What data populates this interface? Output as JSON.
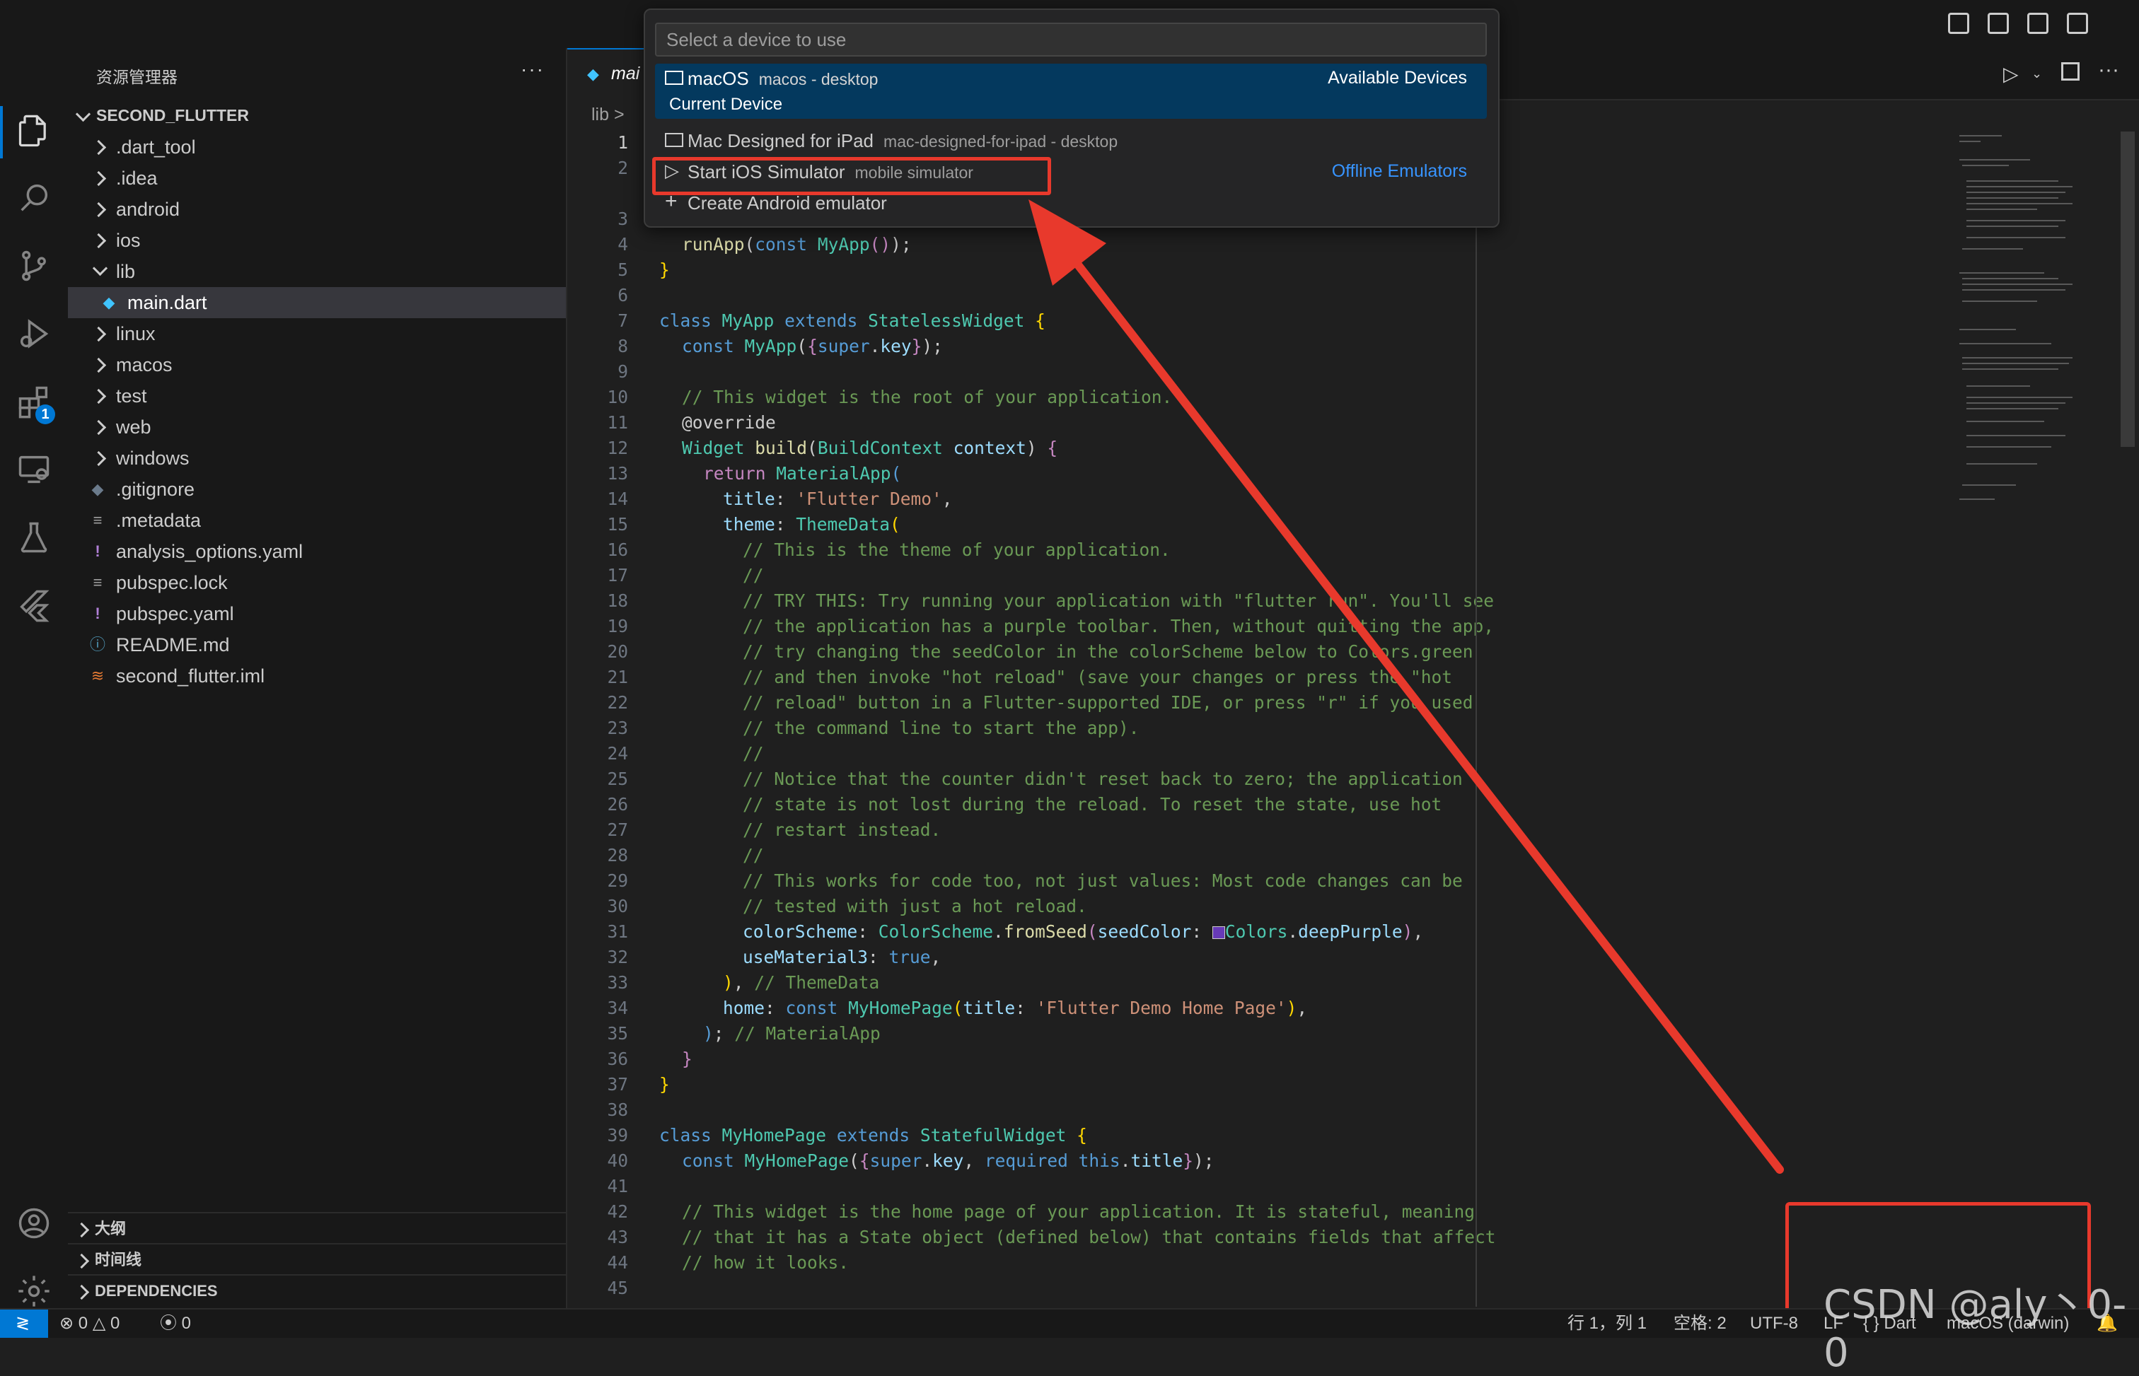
{
  "explorer": {
    "title": "资源管理器",
    "more": "···",
    "project": "SECOND_FLUTTER",
    "items": [
      {
        "label": ".dart_tool"
      },
      {
        "label": ".idea"
      },
      {
        "label": "android"
      },
      {
        "label": "ios"
      },
      {
        "label": "lib"
      },
      {
        "label": "main.dart"
      },
      {
        "label": "linux"
      },
      {
        "label": "macos"
      },
      {
        "label": "test"
      },
      {
        "label": "web"
      },
      {
        "label": "windows"
      },
      {
        "label": ".gitignore"
      },
      {
        "label": ".metadata"
      },
      {
        "label": "analysis_options.yaml"
      },
      {
        "label": "pubspec.lock"
      },
      {
        "label": "pubspec.yaml"
      },
      {
        "label": "README.md"
      },
      {
        "label": "second_flutter.iml"
      }
    ],
    "sections": {
      "outline": "大纲",
      "timeline": "时间线",
      "dependencies": "DEPENDENCIES"
    }
  },
  "activity": {
    "extensions_badge": "1"
  },
  "editor": {
    "tab": "mai",
    "breadcrumb": "lib >",
    "line_numbers": [
      "1",
      "2",
      "3",
      "4",
      "5",
      "6",
      "7",
      "8",
      "9",
      "10",
      "11",
      "12",
      "13",
      "14",
      "15",
      "16",
      "17",
      "18",
      "19",
      "20",
      "21",
      "22",
      "23",
      "24",
      "25",
      "26",
      "27",
      "28",
      "29",
      "30",
      "31",
      "32",
      "33",
      "34",
      "35",
      "36",
      "37",
      "38",
      "39",
      "40",
      "41",
      "42",
      "43",
      "44",
      "45"
    ]
  },
  "quick_pick": {
    "placeholder": "Select a device to use",
    "items": [
      {
        "label": "macOS",
        "description": "macos - desktop",
        "detail": "Current Device",
        "group": "Available Devices"
      },
      {
        "label": "Mac Designed for iPad",
        "description": "mac-designed-for-ipad - desktop"
      },
      {
        "label": "Start iOS Simulator",
        "description": "mobile simulator",
        "group": "Offline Emulators"
      },
      {
        "label": "Create Android emulator"
      }
    ]
  },
  "status_bar": {
    "errors": "0",
    "warnings": "0",
    "ports": "0",
    "position": "行 1，列 1",
    "indent": "空格: 2",
    "encoding": "UTF-8",
    "eol": "LF",
    "language": "Dart",
    "device": "macOS (darwin)"
  },
  "watermark": "CSDN @aly丶0-0",
  "colors": {
    "accent": "#0078d4",
    "annotation": "#e8392c",
    "selection": "#04395e"
  }
}
